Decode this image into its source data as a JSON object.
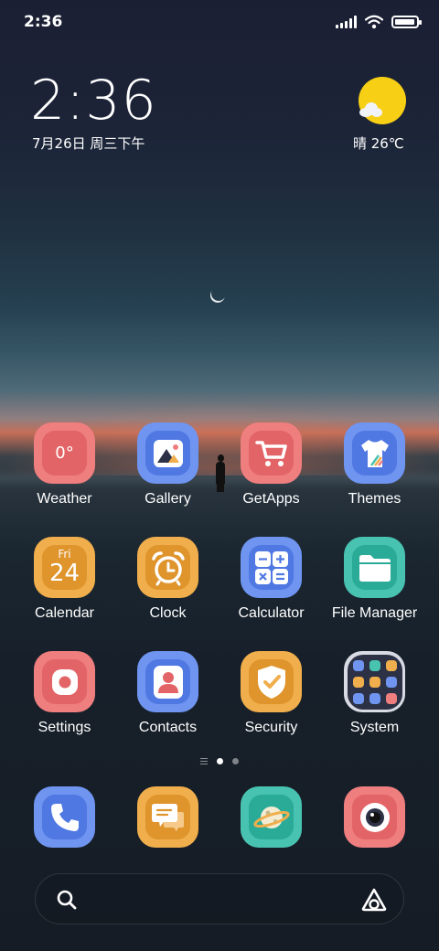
{
  "status_bar": {
    "time": "2:36",
    "icons": [
      "signal-icon",
      "wifi-icon",
      "battery-icon"
    ],
    "battery_level": 0.95
  },
  "clock_widget": {
    "time": "2:36",
    "date": "7月26日 周三下午",
    "weather": "晴 26℃",
    "weather_icon": "sunny-cloud-icon"
  },
  "apps": [
    {
      "label": "Weather",
      "icon": "weather-icon",
      "color": "#ef7e7f",
      "text": "0°"
    },
    {
      "label": "Gallery",
      "icon": "gallery-icon",
      "color": "#6f95f0"
    },
    {
      "label": "GetApps",
      "icon": "cart-icon",
      "color": "#ef7e7f"
    },
    {
      "label": "Themes",
      "icon": "shirt-icon",
      "color": "#6f95f0"
    },
    {
      "label": "Calendar",
      "icon": "calendar-icon",
      "color": "#f0ae4c",
      "day": "Fri",
      "date": "24"
    },
    {
      "label": "Clock",
      "icon": "alarm-clock-icon",
      "color": "#f0ae4c"
    },
    {
      "label": "Calculator",
      "icon": "calculator-icon",
      "color": "#6f95f0"
    },
    {
      "label": "File Manager",
      "icon": "folder-icon",
      "color": "#49c3b1"
    },
    {
      "label": "Settings",
      "icon": "settings-icon",
      "color": "#ef7e7f"
    },
    {
      "label": "Contacts",
      "icon": "contacts-icon",
      "color": "#6f95f0"
    },
    {
      "label": "Security",
      "icon": "shield-check-icon",
      "color": "#f0ae4c"
    },
    {
      "label": "System",
      "icon": "folder-grid-icon",
      "color": "#2c3145"
    }
  ],
  "page_indicator": {
    "pages": 2,
    "active": 0
  },
  "dock": [
    {
      "name": "phone",
      "icon": "phone-icon",
      "color": "#6f95f0"
    },
    {
      "name": "messages",
      "icon": "message-icon",
      "color": "#f0ae4c"
    },
    {
      "name": "browser",
      "icon": "planet-icon",
      "color": "#49c3b1"
    },
    {
      "name": "camera",
      "icon": "camera-icon",
      "color": "#ef7e7f"
    }
  ],
  "search_bar": {
    "icon": "search-icon",
    "assistant_icon": "assistant-icon"
  }
}
